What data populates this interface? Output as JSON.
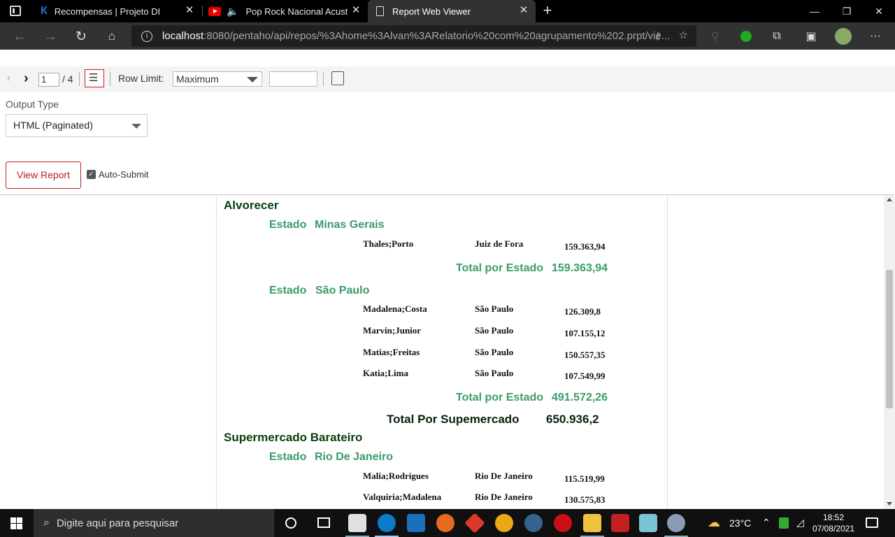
{
  "browser": {
    "tabs": [
      {
        "label": "Recompensas | Projeto DEV",
        "icon": "dev-logo-icon"
      },
      {
        "label": "Pop Rock Nacional Acustico",
        "icon": "youtube-icon"
      },
      {
        "label": "Report Web Viewer",
        "icon": "page-icon",
        "active": true
      }
    ],
    "address": {
      "host": "localhost",
      "path": ":8080/pentaho/api/repos/%3Ahome%3Alvan%3ARelatorio%20com%20agrupamento%202.prpt/vie..."
    }
  },
  "viewer_toolbar": {
    "page_current": "1",
    "page_total": "/ 4",
    "row_limit_label": "Row Limit:",
    "row_limit_value": "Maximum"
  },
  "params": {
    "output_type_label": "Output Type",
    "output_type_value": "HTML (Paginated)",
    "view_report_label": "View Report",
    "auto_submit_label": "Auto-Submit"
  },
  "report": {
    "group1": {
      "name": "Alvorecer",
      "mg_label": "Estado",
      "mg_value": "Minas Gerais",
      "mg_rows": [
        {
          "name": "Thales;Porto",
          "city": "Juiz de Fora",
          "value": "159.363,94"
        }
      ],
      "mg_total_label": "Total por Estado",
      "mg_total_value": "159.363,94",
      "sp_label": "Estado",
      "sp_value": "São Paulo",
      "sp_rows": [
        {
          "name": "Madalena;Costa",
          "city": "São Paulo",
          "value": "126.309,8"
        },
        {
          "name": "Marvin;Junior",
          "city": "São Paulo",
          "value": "107.155,12"
        },
        {
          "name": "Matias;Freitas",
          "city": "São Paulo",
          "value": "150.557,35"
        },
        {
          "name": "Katia;Lima",
          "city": "São Paulo",
          "value": "107.549,99"
        }
      ],
      "sp_total_label": "Total por Estado",
      "sp_total_value": "491.572,26",
      "super_total_label": "Total Por Supemercado",
      "super_total_value": "650.936,2"
    },
    "group2": {
      "name": "Supermercado Barateiro",
      "rj_label": "Estado",
      "rj_value": "Rio De Janeiro",
      "rj_rows": [
        {
          "name": "Malia;Rodrigues",
          "city": "Rio De Janeiro",
          "value": "115.519,99"
        },
        {
          "name": "Valquiria;Madalena",
          "city": "Rio De Janeiro",
          "value": "130.575,83"
        }
      ]
    }
  },
  "taskbar": {
    "search_placeholder": "Digite aqui para pesquisar",
    "weather": "23°C",
    "time": "18:52",
    "date": "07/08/2021"
  }
}
